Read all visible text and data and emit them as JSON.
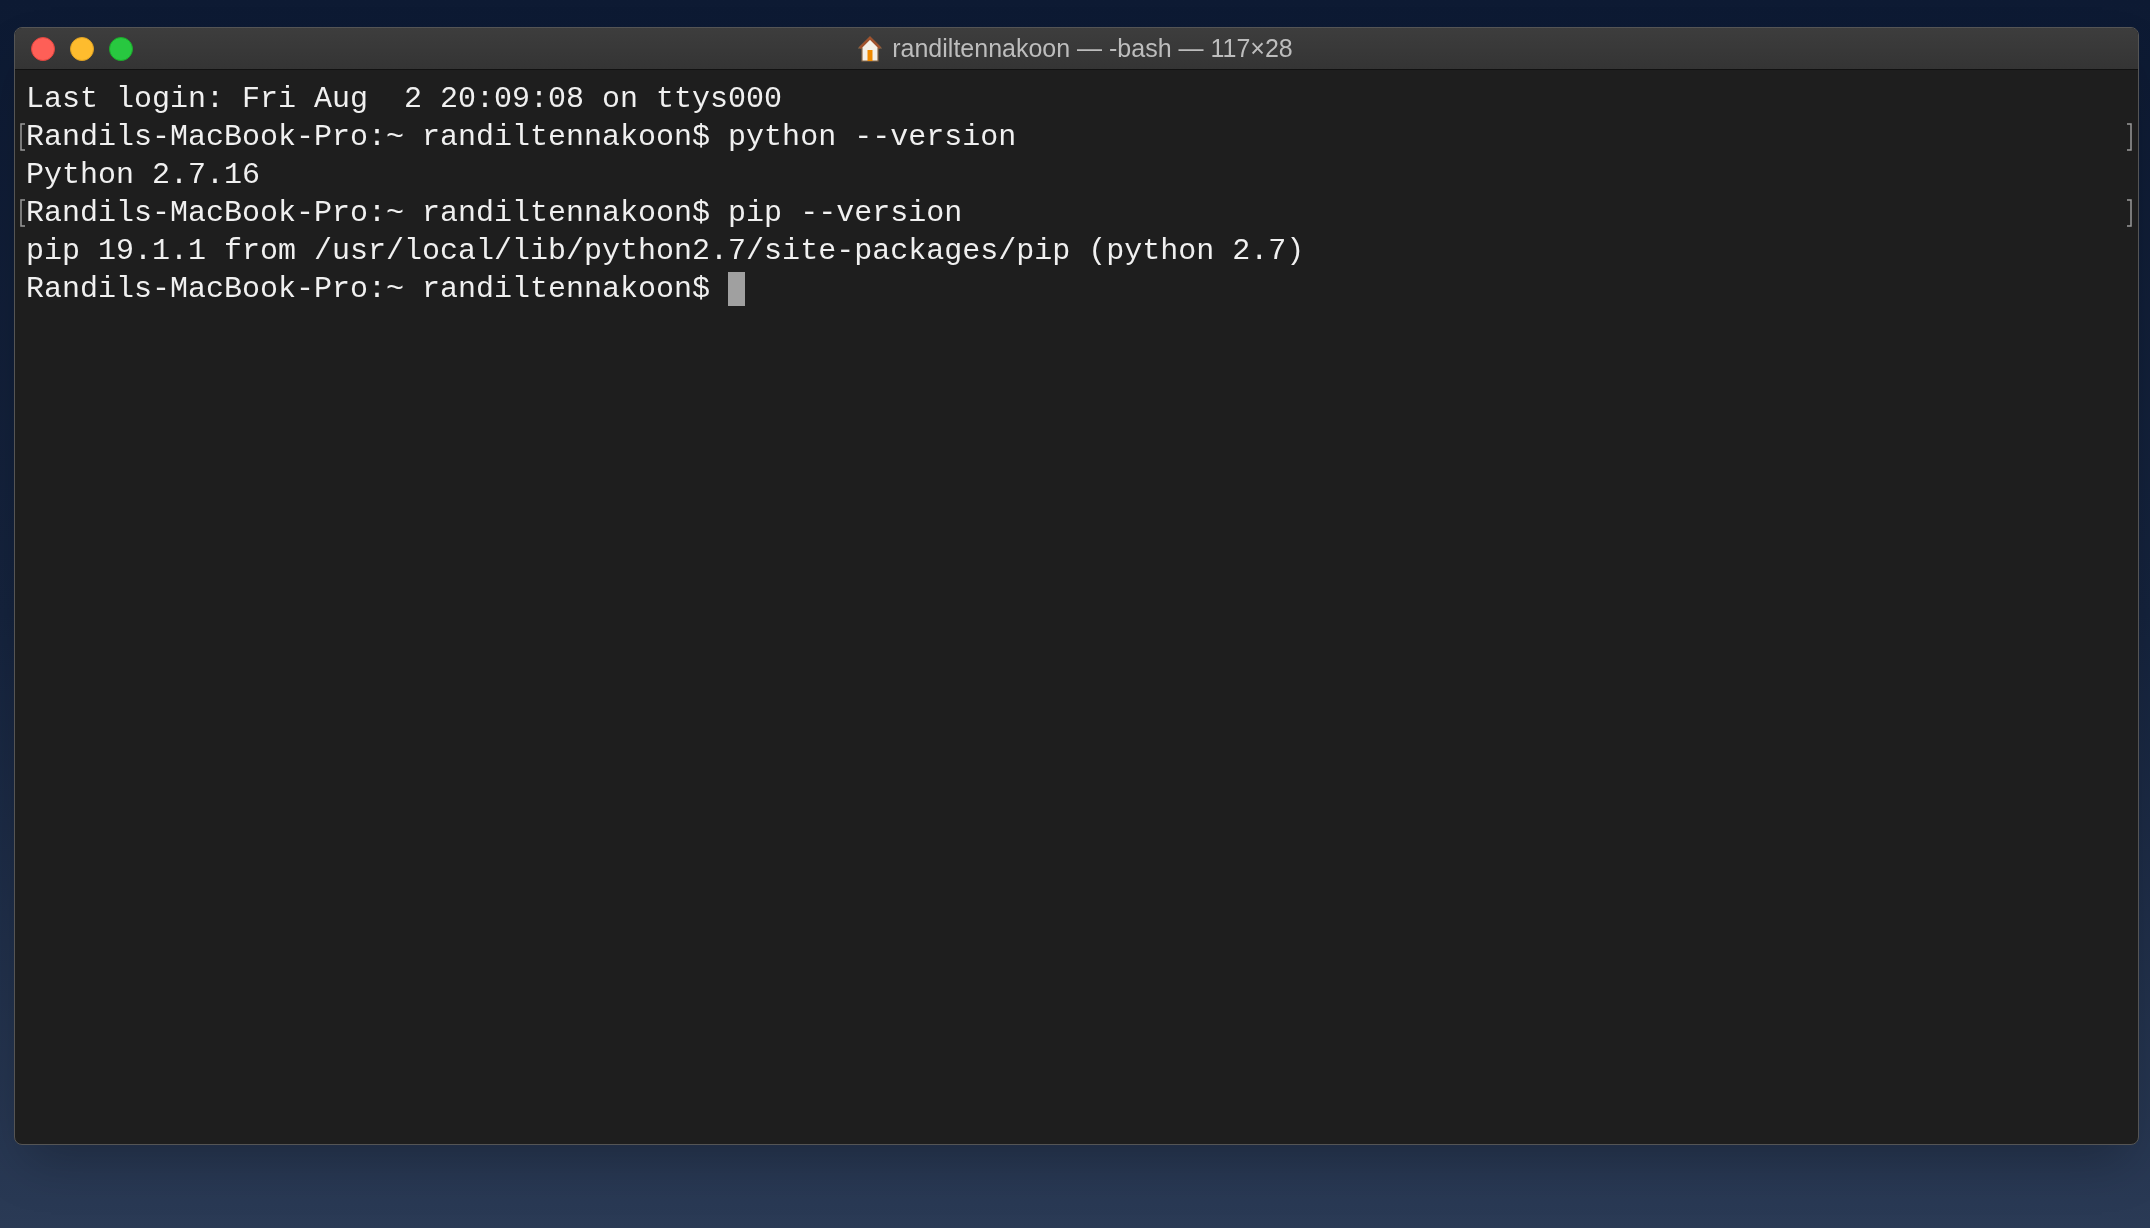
{
  "window": {
    "title": "randiltennakoon — -bash — 117×28"
  },
  "lines": [
    {
      "text": "Last login: Fri Aug  2 20:09:08 on ttys000",
      "marked": false,
      "cursor": false
    },
    {
      "text": "Randils-MacBook-Pro:~ randiltennakoon$ python --version",
      "marked": true,
      "cursor": false
    },
    {
      "text": "Python 2.7.16",
      "marked": false,
      "cursor": false
    },
    {
      "text": "Randils-MacBook-Pro:~ randiltennakoon$ pip --version",
      "marked": true,
      "cursor": false
    },
    {
      "text": "pip 19.1.1 from /usr/local/lib/python2.7/site-packages/pip (python 2.7)",
      "marked": false,
      "cursor": false
    },
    {
      "text": "Randils-MacBook-Pro:~ randiltennakoon$ ",
      "marked": false,
      "cursor": true
    }
  ]
}
